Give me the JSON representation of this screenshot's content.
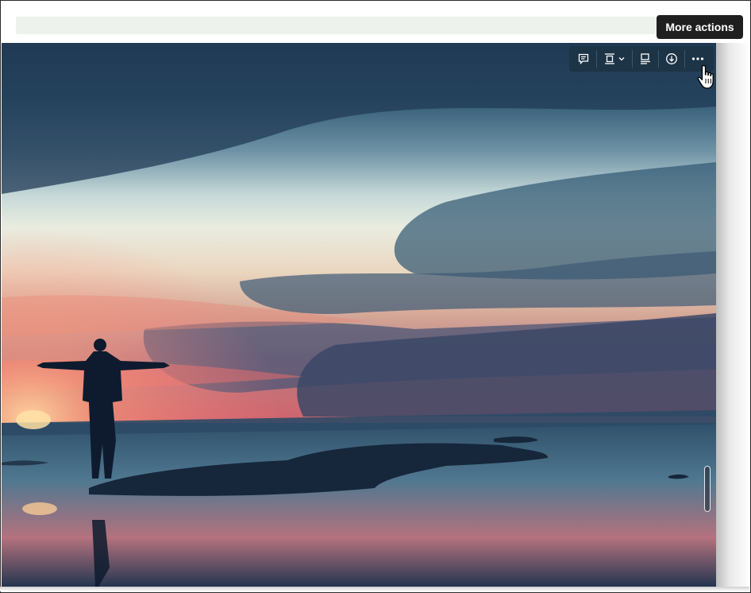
{
  "photo": {
    "icon": "sunset-beach-photo"
  },
  "toolbar": {
    "buttons": [
      {
        "name": "comment-button",
        "icon": "comment-icon"
      },
      {
        "name": "alignment-button",
        "icon": "align-center-icon"
      },
      {
        "name": "caption-button",
        "icon": "caption-icon"
      },
      {
        "name": "download-button",
        "icon": "download-icon"
      },
      {
        "name": "more-actions-button",
        "icon": "ellipsis-icon"
      }
    ]
  },
  "tooltip": {
    "text": "More actions"
  },
  "colors": {
    "toolbar_bg": "#1d3346",
    "tooltip_bg": "#1f1f1f",
    "band_bg": "#eef2ec"
  }
}
